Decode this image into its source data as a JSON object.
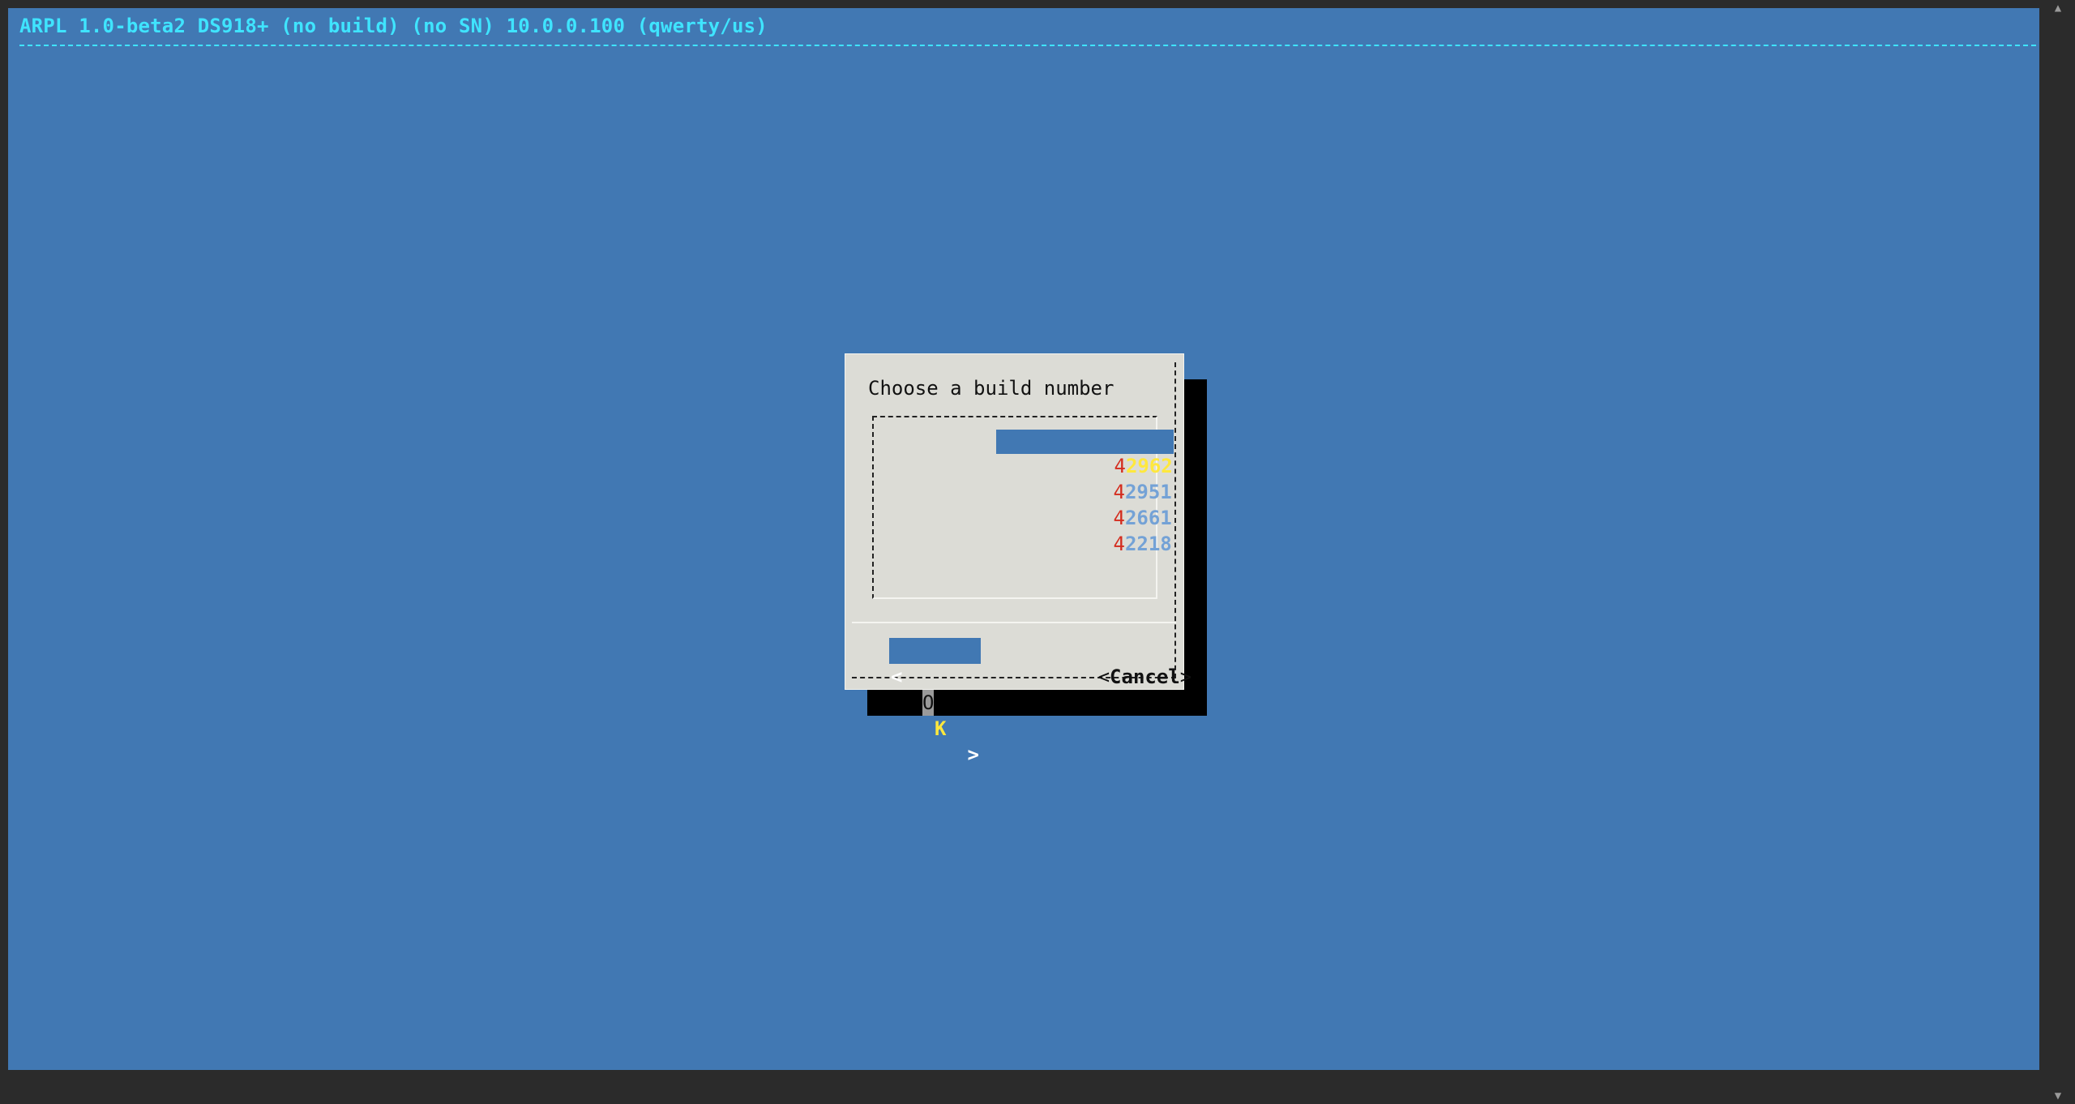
{
  "backtitle": "ARPL 1.0-beta2 DS918+ (no build) (no SN) 10.0.0.100 (qwerty/us)",
  "dialog": {
    "title": "Choose a build number",
    "items": [
      {
        "hotkey": "4",
        "rest": "2962",
        "selected": true
      },
      {
        "hotkey": "4",
        "rest": "2951",
        "selected": false
      },
      {
        "hotkey": "4",
        "rest": "2661",
        "selected": false
      },
      {
        "hotkey": "4",
        "rest": "2218",
        "selected": false
      }
    ],
    "ok_button": {
      "left_bracket": "<",
      "label_first": "O",
      "label_rest": "K",
      "right_bracket": ">"
    },
    "cancel_button": {
      "left_bracket": "<",
      "label": "Cancel",
      "right_bracket": ">"
    }
  },
  "colors": {
    "background": "#4178b3",
    "backtitle": "#3fe4ff",
    "dialog": "#dcdcd6",
    "hotkey": "#d42c1e",
    "selected_text": "#ffe83d",
    "item_text": "#74a2d6"
  },
  "icons": {
    "scroll_up": "triangle-up-icon",
    "scroll_down": "triangle-down-icon"
  }
}
